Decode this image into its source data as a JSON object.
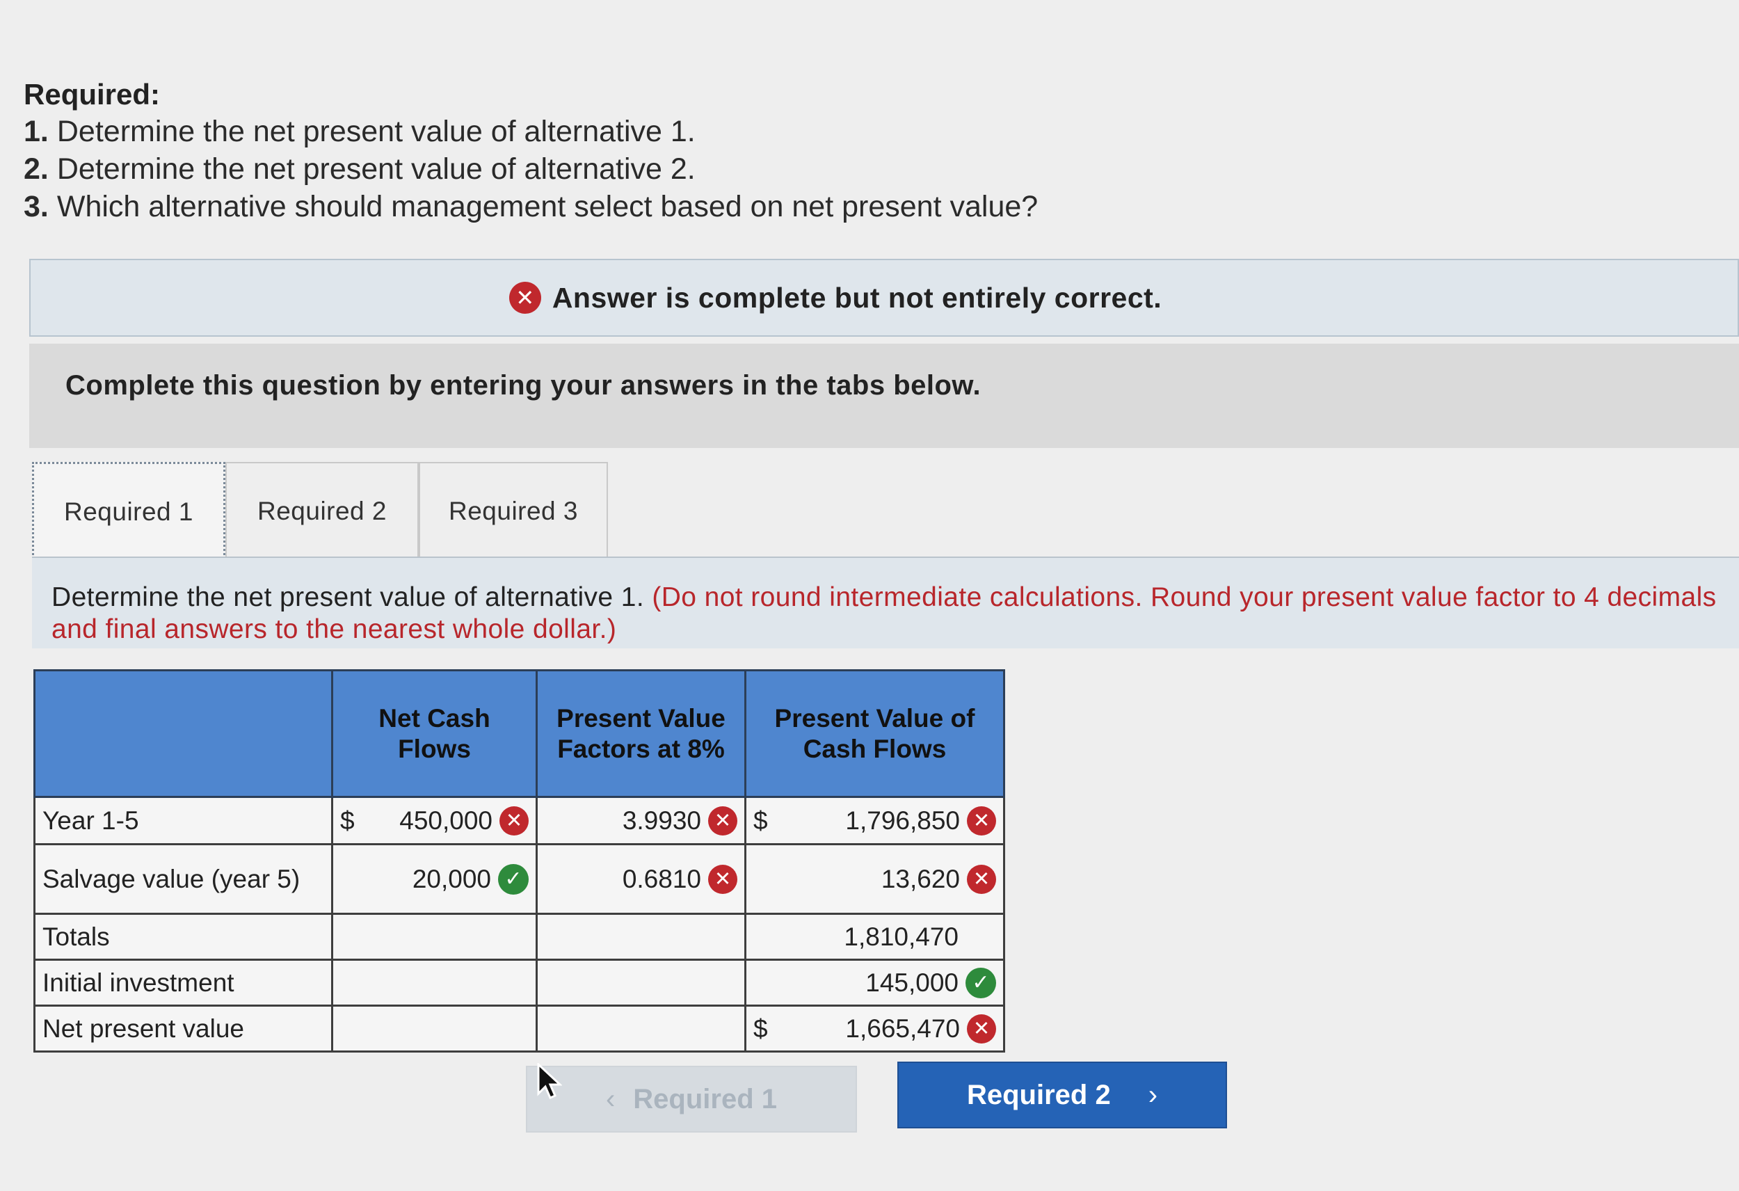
{
  "required": {
    "title": "Required:",
    "items": [
      {
        "num": "1.",
        "text": "Determine the net present value of alternative 1."
      },
      {
        "num": "2.",
        "text": "Determine the net present value of alternative 2."
      },
      {
        "num": "3.",
        "text": "Which alternative should management select based on net present value?"
      }
    ]
  },
  "feedback": {
    "icon": "x-circle-icon",
    "text": "Answer is complete but not entirely correct."
  },
  "instruction": "Complete this question by entering your answers in the tabs below.",
  "tabs": [
    {
      "label": "Required 1",
      "active": true
    },
    {
      "label": "Required 2",
      "active": false
    },
    {
      "label": "Required 3",
      "active": false
    }
  ],
  "prompt": {
    "main": "Determine the net present value of alternative 1.",
    "note": "(Do not round intermediate calculations. Round your present value factor to 4 decimals and final answers to the nearest whole dollar.)"
  },
  "table": {
    "headers": [
      "",
      "Net Cash Flows",
      "Present Value Factors at 8%",
      "Present Value of Cash Flows"
    ],
    "rows": [
      {
        "label": "Year 1-5",
        "cash_dollar": "$",
        "cash": "450,000",
        "cash_status": "incorrect",
        "factor": "3.9930",
        "factor_status": "incorrect",
        "pv_dollar": "$",
        "pv": "1,796,850",
        "pv_status": "incorrect"
      },
      {
        "label": "Salvage value (year 5)",
        "cash_dollar": "",
        "cash": "20,000",
        "cash_status": "correct",
        "factor": "0.6810",
        "factor_status": "incorrect",
        "pv_dollar": "",
        "pv": "13,620",
        "pv_status": "incorrect"
      },
      {
        "label": "Totals",
        "cash_dollar": "",
        "cash": "",
        "cash_status": "",
        "factor": "",
        "factor_status": "",
        "pv_dollar": "",
        "pv": "1,810,470",
        "pv_status": ""
      },
      {
        "label": "Initial investment",
        "cash_dollar": "",
        "cash": "",
        "cash_status": "",
        "factor": "",
        "factor_status": "",
        "pv_dollar": "",
        "pv": "145,000",
        "pv_status": "correct"
      },
      {
        "label": "Net present value",
        "cash_dollar": "",
        "cash": "",
        "cash_status": "",
        "factor": "",
        "factor_status": "",
        "pv_dollar": "$",
        "pv": "1,665,470",
        "pv_status": "incorrect"
      }
    ]
  },
  "nav": {
    "prev_label": "Required 1",
    "next_label": "Required 2",
    "prev_enabled": false
  },
  "colors": {
    "header_blue": "#4f86cf",
    "incorrect_red": "#c0282d",
    "correct_green": "#2e8b3c",
    "button_blue": "#2563b6"
  }
}
